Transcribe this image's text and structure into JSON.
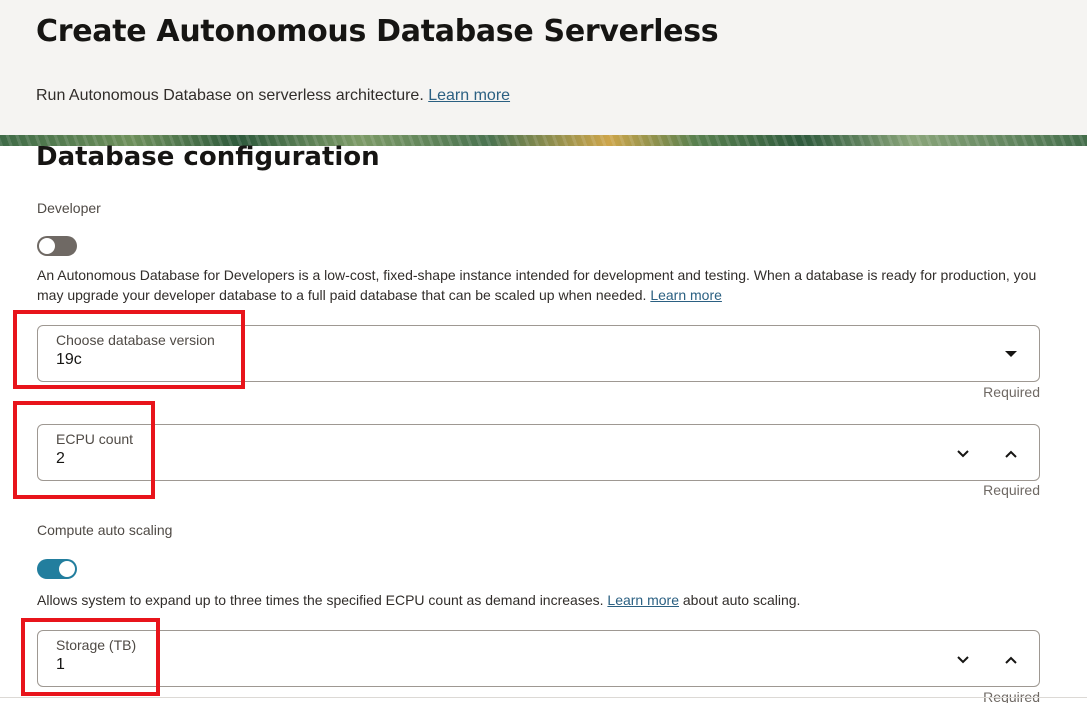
{
  "header": {
    "title": "Create Autonomous Database Serverless",
    "subtitle_text": "Run Autonomous Database on serverless architecture.",
    "subtitle_link": "Learn more"
  },
  "section": {
    "title": "Database configuration"
  },
  "developer": {
    "label": "Developer",
    "toggle_state": "off",
    "help_text": "An Autonomous Database for Developers is a low-cost, fixed-shape instance intended for development and testing. When a database is ready for production, you may upgrade your developer database to a full paid database that can be scaled up when needed.",
    "help_link": "Learn more"
  },
  "database_version": {
    "label": "Choose database version",
    "value": "19c",
    "required": "Required",
    "icon": "chevron-down-icon"
  },
  "ecpu_count": {
    "label": "ECPU count",
    "value": "2",
    "required": "Required",
    "icons": [
      "decrement-icon",
      "increment-icon"
    ]
  },
  "auto_scaling": {
    "label": "Compute auto scaling",
    "toggle_state": "on",
    "help_text_before": "Allows system to expand up to three times the specified ECPU count as demand increases.",
    "help_link": "Learn more",
    "help_text_after": "about auto scaling."
  },
  "storage": {
    "label": "Storage (TB)",
    "value": "1",
    "required": "Required",
    "icons": [
      "decrement-icon",
      "increment-icon"
    ]
  },
  "colors": {
    "accent": "#227e9e",
    "link": "#2b6082",
    "highlight": "#e8141b",
    "toggle_off": "#6f6964"
  }
}
